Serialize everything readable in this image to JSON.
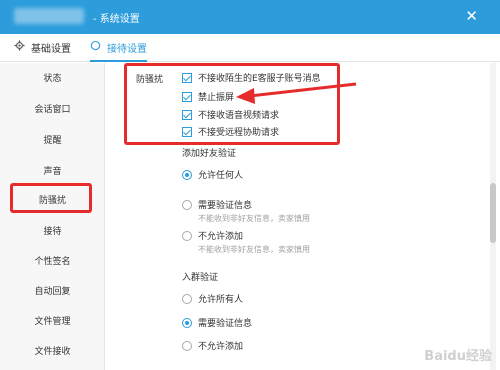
{
  "window": {
    "title": "- 系统设置",
    "close_symbol": "✕"
  },
  "tabs": [
    {
      "label": "基础设置",
      "icon": "gear-icon",
      "active": false
    },
    {
      "label": "接待设置",
      "icon": "circle-icon",
      "active": true
    }
  ],
  "sidebar": {
    "items": [
      {
        "label": "状态"
      },
      {
        "label": "会话窗口"
      },
      {
        "label": "提醒"
      },
      {
        "label": "声音"
      },
      {
        "label": "防骚扰",
        "active": true
      },
      {
        "label": "接待"
      },
      {
        "label": "个性签名"
      },
      {
        "label": "自动回复"
      },
      {
        "label": "文件管理"
      },
      {
        "label": "文件接收"
      }
    ]
  },
  "anti_harassment": {
    "section_label": "防骚扰",
    "checks": [
      {
        "label": "不接收陌生的E客服子账号消息",
        "checked": true
      },
      {
        "label": "禁止振屏",
        "checked": true
      },
      {
        "label": "不接收语音视频请求",
        "checked": true
      },
      {
        "label": "不接受远程协助请求",
        "checked": true
      }
    ]
  },
  "friend_verify": {
    "title": "添加好友验证",
    "options": [
      {
        "label": "允许任何人",
        "selected": true,
        "hint": ""
      },
      {
        "label": "需要验证信息",
        "selected": false,
        "hint": "不能收到非好友信息，卖家慎用"
      },
      {
        "label": "不允许添加",
        "selected": false,
        "hint": "不能收到非好友信息，卖家慎用"
      }
    ]
  },
  "group_verify": {
    "title": "入群验证",
    "options": [
      {
        "label": "允许所有人",
        "selected": false
      },
      {
        "label": "需要验证信息",
        "selected": true
      },
      {
        "label": "不允许添加",
        "selected": false
      }
    ]
  },
  "watermark": "Baidu经验",
  "colors": {
    "accent": "#2d9cdb",
    "highlight": "#e52b2b"
  }
}
